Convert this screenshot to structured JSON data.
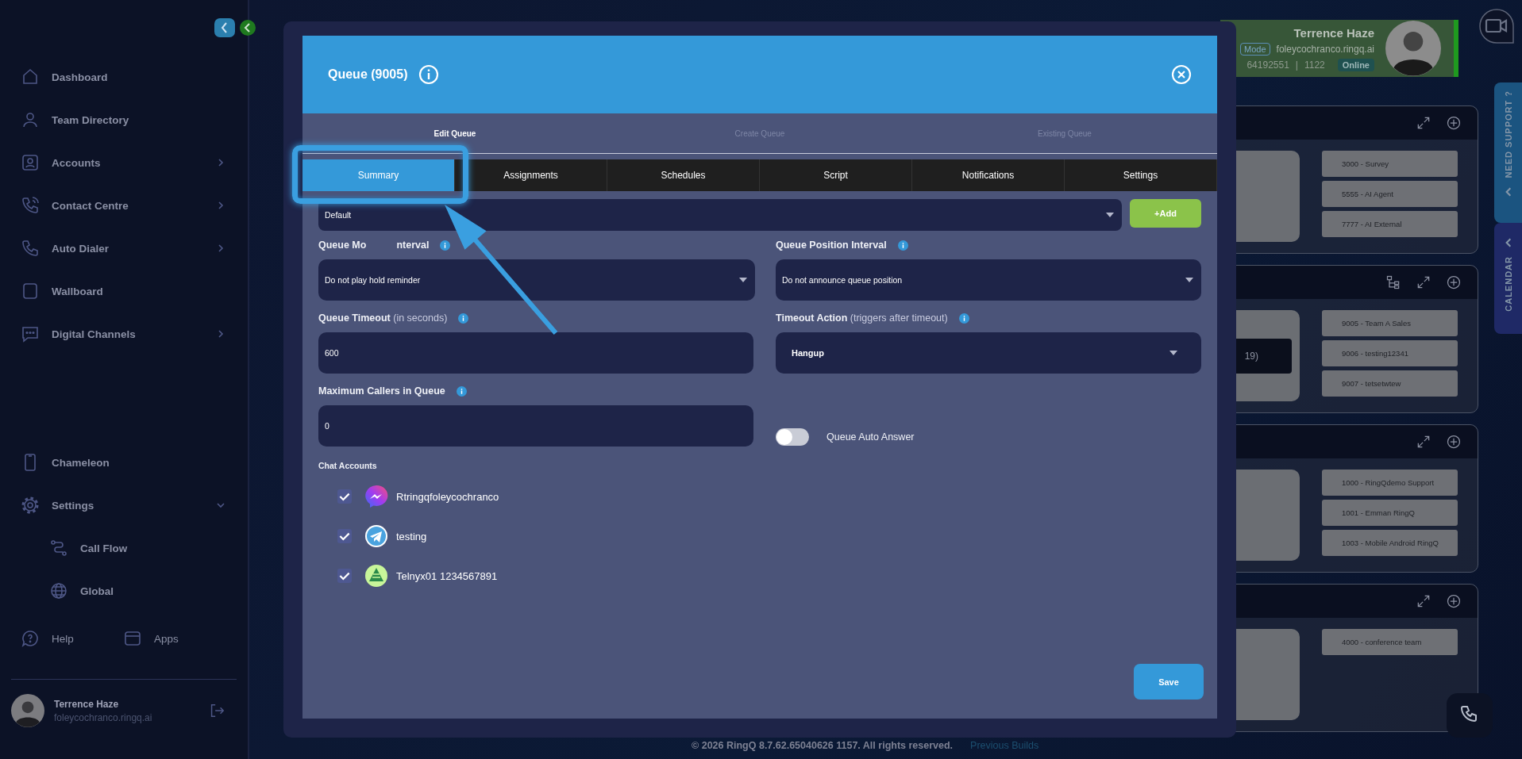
{
  "sidebar": {
    "items": [
      {
        "label": "Dashboard",
        "kind": "link"
      },
      {
        "label": "Team Directory",
        "kind": "link"
      },
      {
        "label": "Accounts",
        "kind": "group",
        "expanded": false
      },
      {
        "label": "Contact Centre",
        "kind": "group",
        "expanded": false
      },
      {
        "label": "Auto Dialer",
        "kind": "group",
        "expanded": false
      },
      {
        "label": "Wallboard",
        "kind": "link"
      },
      {
        "label": "Digital Channels",
        "kind": "group",
        "expanded": false
      }
    ],
    "bottom_items": [
      {
        "label": "Chameleon",
        "kind": "link"
      },
      {
        "label": "Settings",
        "kind": "group",
        "expanded": true,
        "children": [
          {
            "label": "Call Flow"
          },
          {
            "label": "Global"
          }
        ]
      }
    ],
    "footer_links": [
      {
        "label": "Help"
      },
      {
        "label": "Apps"
      }
    ],
    "user": {
      "name": "Terrence Haze",
      "email": "foleycochranco.ringq.ai"
    }
  },
  "profile_card": {
    "mode": "Mode",
    "name": "Terrence Haze",
    "email": "foleycochranco.ringq.ai",
    "phone": "64192551",
    "separator": "|",
    "extension": "1122",
    "status": "Online"
  },
  "side_tabs": [
    {
      "label": "NEED SUPPORT ?"
    },
    {
      "label": "CALENDAR"
    }
  ],
  "panels": [
    {
      "flow_icon": false,
      "items": [
        "3000 - Survey",
        "5555 - AI Agent",
        "7777 - AI External"
      ]
    },
    {
      "flow_icon": true,
      "card_text": "19)",
      "items": [
        "9005 - Team A Sales",
        "9006 - testing12341",
        "9007 - tetsetwtew"
      ]
    },
    {
      "flow_icon": false,
      "items": [
        "1000 - RingQdemo Support",
        "1001 - Emman RingQ",
        "1003 - Mobile Android RingQ"
      ]
    },
    {
      "flow_icon": false,
      "items": [
        "4000 - conference team"
      ]
    }
  ],
  "modal": {
    "title": "Queue (9005)",
    "steps": [
      {
        "label": "Edit Queue",
        "selected": true
      },
      {
        "label": "Create Queue",
        "selected": false
      },
      {
        "label": "Existing Queue",
        "selected": false
      }
    ],
    "tabs": [
      {
        "label": "Summary",
        "selected": true,
        "highlighted": true
      },
      {
        "label": "Assignments",
        "selected": false,
        "highlighted": false
      },
      {
        "label": "Schedules",
        "selected": false,
        "highlighted": false
      },
      {
        "label": "Script",
        "selected": false,
        "highlighted": false
      },
      {
        "label": "Notifications",
        "selected": false,
        "highlighted": false
      },
      {
        "label": "Settings",
        "selected": false,
        "highlighted": false
      }
    ],
    "top_select": {
      "value": "Default"
    },
    "add_button": "+Add",
    "music_interval": {
      "label_parts": [
        "Queue Mo",
        "nterval"
      ],
      "value": "Do not play hold reminder"
    },
    "position_interval": {
      "label": "Queue Position Interval",
      "value": "Do not announce queue position"
    },
    "timeout": {
      "label": "Queue Timeout",
      "hint": "(in seconds)",
      "value": "600"
    },
    "timeout_action": {
      "label": "Timeout Action",
      "hint": "(triggers after timeout)",
      "value": "Hangup"
    },
    "max_callers": {
      "label": "Maximum Callers in Queue",
      "value": "0"
    },
    "auto_answer": {
      "label": "Queue Auto Answer",
      "on": false
    },
    "chat_accounts": {
      "label": "Chat Accounts",
      "items": [
        {
          "name": "Rtringqfoleycochranco",
          "checked": true
        },
        {
          "name": "testing",
          "checked": true
        },
        {
          "name": "Telnyx01 1234567891",
          "checked": true
        }
      ]
    },
    "save_button": "Save"
  },
  "footer": {
    "copyright": "© 2026 RingQ 8.7.62.65040626 1157. All rights reserved.",
    "link": "Previous Builds"
  }
}
